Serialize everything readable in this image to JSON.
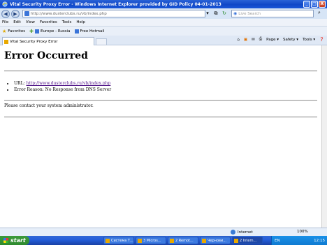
{
  "window": {
    "title": "Vital Security Proxy Error - Windows Internet Explorer provided by GID Policy 04-01-2013",
    "buttons": [
      "_",
      "□",
      "X"
    ]
  },
  "address_bar": {
    "url": "http://www.dusterclubs.ru/vb/index.php",
    "search_placeholder": "Live Search"
  },
  "menu": [
    "File",
    "Edit",
    "View",
    "Favorites",
    "Tools",
    "Help"
  ],
  "favorites_bar": {
    "label": "Favorites",
    "items": [
      "Europe - Russia",
      "Free Hotmail"
    ]
  },
  "tab": {
    "title": "Vital Security Proxy Error"
  },
  "command_bar": [
    "Page ▾",
    "Safety ▾",
    "Tools ▾"
  ],
  "content": {
    "heading": "Error Occurred",
    "url_label": "URL:",
    "url": "http://www.dusterclubs.ru/vb/index.php",
    "reason": "Error Reason: No Response from DNS Server",
    "contact": "Please contact your system administrator."
  },
  "status_bar": {
    "zone": "Internet",
    "zoom": "100%"
  },
  "taskbar": {
    "start": "start",
    "items": [
      "Система Т...",
      "3 Micros...",
      "2 Remot...",
      "Чернови...",
      "2 Intern..."
    ],
    "lang": "EN",
    "clock": "12:15"
  }
}
